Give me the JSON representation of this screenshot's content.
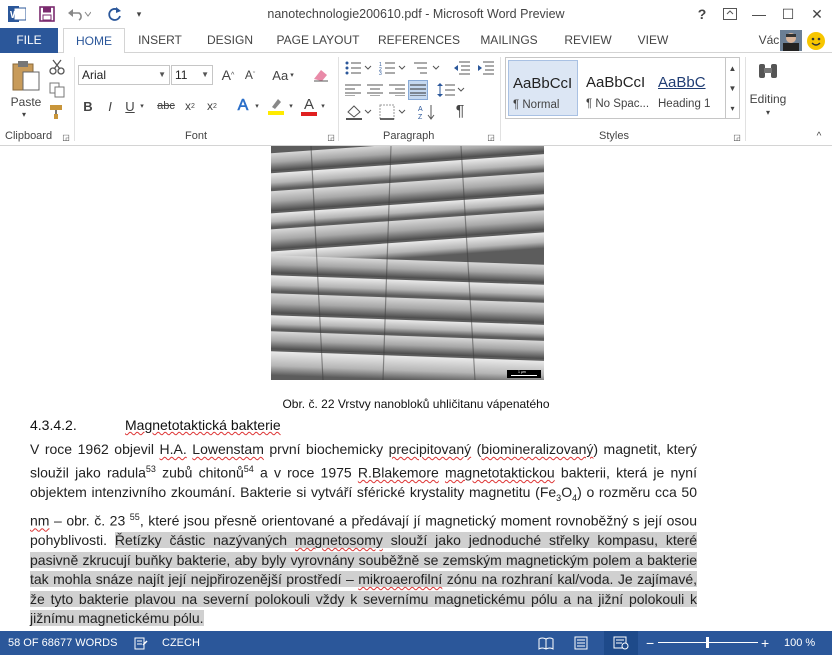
{
  "titlebar": {
    "title": "nanotechnologie200610.pdf - Microsoft Word Preview",
    "help": "?",
    "controls": [
      "—",
      "☐",
      "✕"
    ]
  },
  "tabs": [
    "FILE",
    "HOME",
    "INSERT",
    "DESIGN",
    "PAGE LAYOUT",
    "REFERENCES",
    "MAILINGS",
    "REVIEW",
    "VIEW"
  ],
  "active_tab": "HOME",
  "user": {
    "name": "Václav"
  },
  "ribbon": {
    "clipboard": {
      "label": "Clipboard",
      "paste": "Paste"
    },
    "font": {
      "label": "Font",
      "family": "Arial",
      "size": "11",
      "grow": "A",
      "shrink": "A",
      "case": "Aa",
      "bold": "B",
      "italic": "I",
      "underline": "U",
      "strike": "abc",
      "sub": "x",
      "sup": "x",
      "font_color": "A",
      "effects": "A"
    },
    "paragraph": {
      "label": "Paragraph",
      "pilcrow": "¶"
    },
    "styles": {
      "label": "Styles",
      "items": [
        {
          "sample": "AaBbCcI",
          "name": "¶ Normal"
        },
        {
          "sample": "AaBbCcI",
          "name": "¶ No Spac..."
        },
        {
          "sample": "AaBbC",
          "name": "Heading 1"
        }
      ]
    },
    "editing": {
      "label": "Editing"
    }
  },
  "document": {
    "figure_scale": "1 µm",
    "caption": "Obr. č. 22 Vrstvy nanobloků uhličitanu vápenatého",
    "heading_number": "4.3.4.2.",
    "heading_text": "Magnetotaktická bakterie",
    "paragraph": {
      "p1": "V roce 1962 objevil ",
      "p2": "H.A.",
      "p3": " ",
      "p4": "Lowenstam",
      "p5": " první biochemicky ",
      "p6": "precipitovaný",
      "p7": " (",
      "p8": "biomineralizovaný",
      "p9": ") magnetit, který sloužil jako radula",
      "sup1": "53",
      "p10": " zubů chitonů",
      "sup2": "54",
      "p11": " a v roce 1975 ",
      "p12": "R.Blakemore",
      "p13": " ",
      "p14": "magnetotaktickou",
      "p15": " bakterii, která je nyní objektem intenzivního zkoumání. Bakterie si vytváří sférické krystality magnetitu (Fe",
      "sub1": "3",
      "p16": "O",
      "sub2": "4",
      "p17": ") o rozměru cca 50 ",
      "p18": "nm",
      "p19": " – obr. č. 23 ",
      "sup3": "55",
      "p20": ", které jsou přesně orientované a předávají jí magnetický moment rovnoběžný s její osou pohyblivosti. ",
      "h1": "Řetízky částic nazývaných ",
      "h2": "magnetosomy",
      "h3": " slouží jako jednoduché střelky kompasu, které pasivně zkrucují buňky bakterie, aby byly vyrovnány souběžně se zemským magnetickým polem a bakterie tak mohla snáze najít její nejpřirozenější prostředí – ",
      "h4": "mikroaerofilní",
      "h5": " zónu na rozhraní kal/voda. Je zajímavé, že tyto bakterie plavou na severní polokouli vždy k severnímu magnetickému pólu a na jižní polokouli k jižnímu magnetickému pólu. "
    }
  },
  "status": {
    "words": "58 OF 68677 WORDS",
    "language": "CZECH",
    "zoom": "100 %",
    "zoom_minus": "−",
    "zoom_plus": "+"
  },
  "colors": {
    "accent": "#2b579a",
    "highlight": "#d0d0d0",
    "squiggle": "#dd3333"
  }
}
